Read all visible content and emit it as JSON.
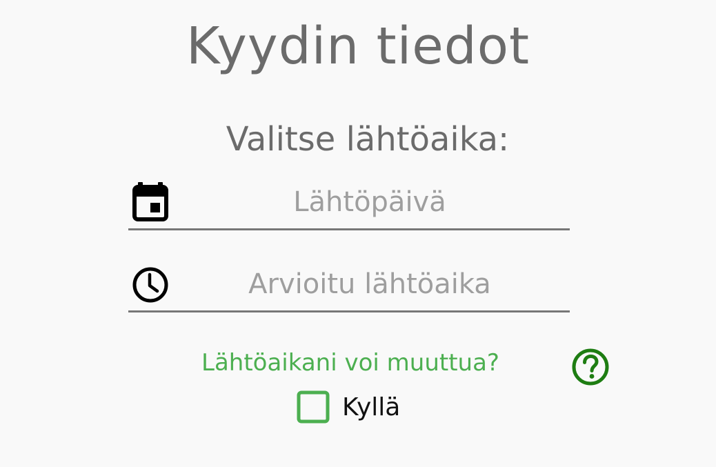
{
  "header": {
    "title": "Kyydin tiedot"
  },
  "departure": {
    "prompt": "Valitse lähtöaika:",
    "date_field": {
      "placeholder": "Lähtöpäivä",
      "value": "",
      "icon": "calendar-icon"
    },
    "time_field": {
      "placeholder": "Arvioitu lähtöaika",
      "value": "",
      "icon": "clock-icon"
    }
  },
  "flexibility": {
    "question": "Lähtöaikani voi muuttua?",
    "help_icon": "help-circle-icon",
    "checkbox_label": "Kyllä",
    "checked": false
  },
  "colors": {
    "accent_green": "#4caf50",
    "help_green": "#1e7d12",
    "title_gray": "#6b6b6b",
    "placeholder_gray": "#9e9e9e",
    "underline_gray": "#777777",
    "background": "#f9f9f9"
  }
}
